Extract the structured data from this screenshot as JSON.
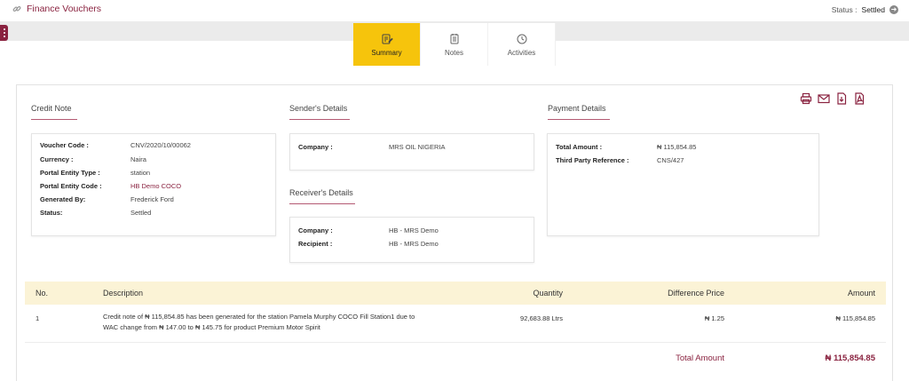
{
  "header": {
    "title": "Finance Vouchers",
    "status_label": "Status :",
    "status_value": "Settled"
  },
  "tabs": [
    {
      "label": "Summary",
      "icon": "clipboard-edit-icon",
      "active": true
    },
    {
      "label": "Notes",
      "icon": "notepad-icon",
      "active": false
    },
    {
      "label": "Activities",
      "icon": "clock-icon",
      "active": false
    }
  ],
  "credit_note": {
    "title": "Credit Note",
    "fields": [
      {
        "label": "Voucher Code :",
        "value": "CNV/2020/10/00062"
      },
      {
        "label": "Currency :",
        "value": "Naira"
      },
      {
        "label": "Portal Entity Type :",
        "value": "station"
      },
      {
        "label": "Portal Entity Code :",
        "value": "HB Demo COCO"
      },
      {
        "label": "Generated By:",
        "value": "Frederick Ford"
      },
      {
        "label": "Status:",
        "value": "Settled"
      }
    ]
  },
  "sender": {
    "title": "Sender's Details",
    "fields": [
      {
        "label": "Company :",
        "value": "MRS OIL NIGERIA"
      }
    ]
  },
  "receiver": {
    "title": "Receiver's Details",
    "fields": [
      {
        "label": "Company :",
        "value": "HB - MRS Demo"
      },
      {
        "label": "Recipient :",
        "value": "HB - MRS Demo"
      }
    ]
  },
  "payment": {
    "title": "Payment Details",
    "fields": [
      {
        "label": "Total Amount :",
        "value": "₦ 115,854.85"
      },
      {
        "label": "Third Party Reference :",
        "value": "CNS/427"
      }
    ]
  },
  "table": {
    "headers": {
      "no": "No.",
      "description": "Description",
      "quantity": "Quantity",
      "difference_price": "Difference Price",
      "amount": "Amount"
    },
    "rows": [
      {
        "no": "1",
        "description": "Credit note of ₦ 115,854.85 has been generated for the station Pamela Murphy COCO Fill Station1 due to WAC change from ₦ 147.00 to ₦ 145.75 for product Premium Motor Spirit",
        "quantity": "92,683.88 Ltrs",
        "difference_price": "₦ 1.25",
        "amount": "₦ 115,854.85"
      }
    ],
    "total_label": "Total Amount",
    "total_value": "₦ 115,854.85"
  },
  "colors": {
    "accent": "#8a2340",
    "tab_active": "#f6c40c",
    "table_header": "#fbf3d6"
  }
}
